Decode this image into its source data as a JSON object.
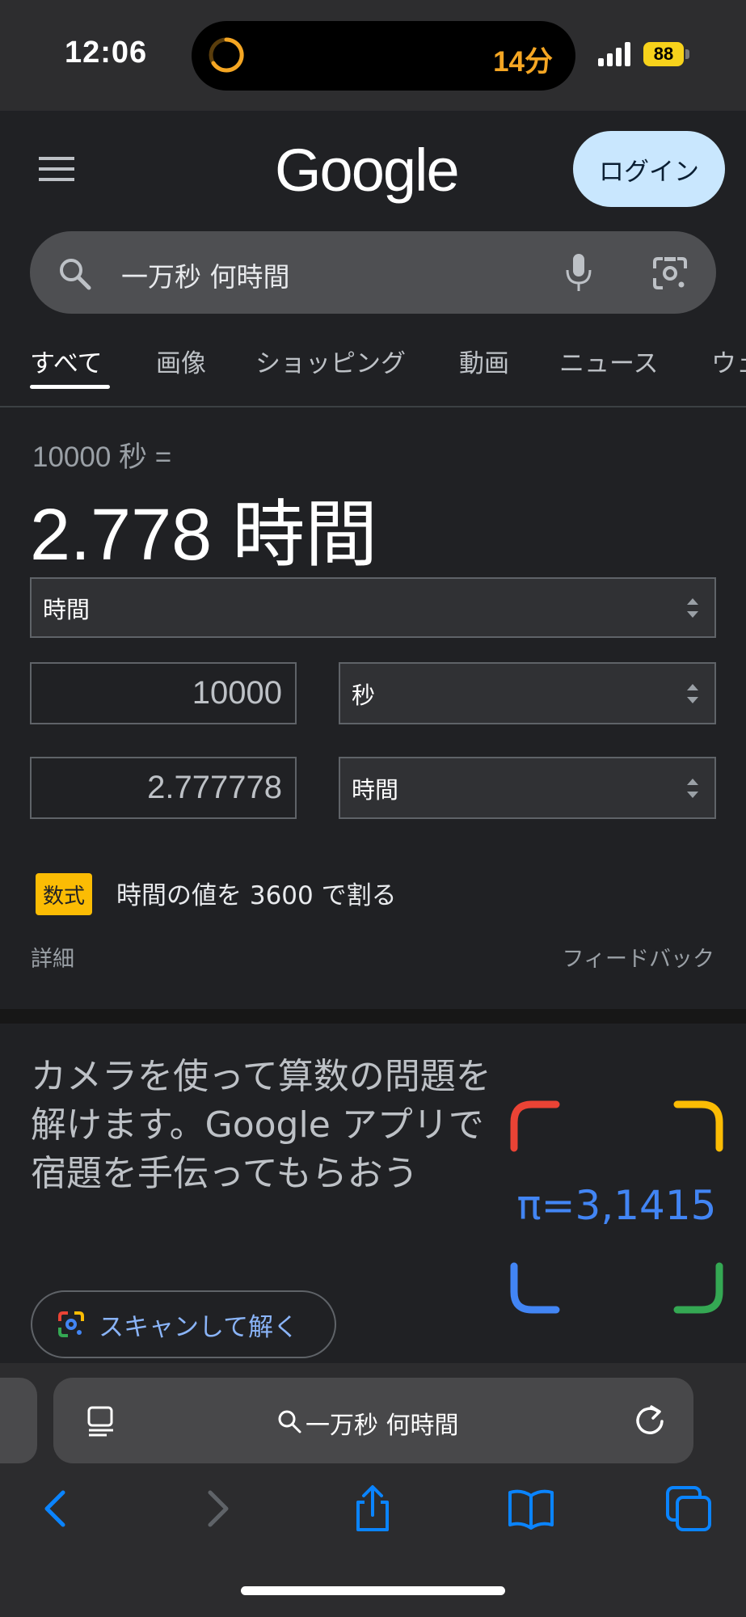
{
  "status_bar": {
    "time": "12:06",
    "island_timer": "14分",
    "battery_level": "88",
    "timer_ring_color": "#f5a623"
  },
  "header": {
    "logo_text": "Google",
    "login_label": "ログイン"
  },
  "search": {
    "query": "一万秒 何時間",
    "icons": [
      "search-icon",
      "mic-icon",
      "google-lens-icon"
    ]
  },
  "tabs": [
    {
      "label": "すべて",
      "active": true
    },
    {
      "label": "画像",
      "active": false
    },
    {
      "label": "ショッピング",
      "active": false
    },
    {
      "label": "動画",
      "active": false
    },
    {
      "label": "ニュース",
      "active": false
    },
    {
      "label": "ウェ",
      "active": false
    }
  ],
  "converter": {
    "source_text": "10000 秒 =",
    "result_text": "2.778 時間",
    "category": "時間",
    "from_value": "10000",
    "from_unit": "秒",
    "to_value": "2.777778",
    "to_unit": "時間",
    "formula_badge": "数式",
    "formula_text": "時間の値を 3600 で割る",
    "details_label": "詳細",
    "feedback_label": "フィードバック"
  },
  "promo": {
    "text": "カメラを使って算数の問題を解けます。Google アプリで宿題を手伝ってもらおう",
    "image_text": "π=3,1415",
    "scan_button_label": "スキャンして解く",
    "corner_colors": [
      "#ea4335",
      "#fbbc04",
      "#4285f4",
      "#34a853"
    ]
  },
  "safari": {
    "address_text": "一万秒 何時間",
    "toolbar_icons": [
      "back-icon",
      "forward-icon",
      "share-icon",
      "bookmarks-icon",
      "tabs-icon"
    ],
    "accent_color": "#0a84ff"
  }
}
